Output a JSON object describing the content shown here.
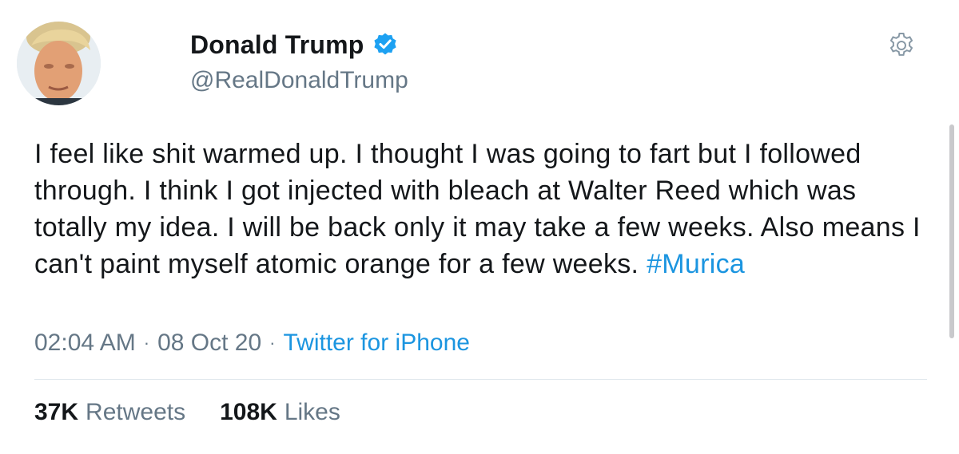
{
  "user": {
    "display_name": "Donald Trump",
    "handle": "@RealDonaldTrump",
    "verified": true
  },
  "tweet": {
    "text": "I feel like shit warmed up. I thought I was going to fart but I followed through. I think I got injected with bleach at Walter Reed which was totally my idea. I will be back only it may take a few weeks. Also means I can't paint myself atomic orange for a few weeks. ",
    "hashtag": "#Murica",
    "time": "02:04 AM",
    "date": "08 Oct 20",
    "separator": "·",
    "source": "Twitter for iPhone"
  },
  "stats": {
    "retweets_count": "37K",
    "retweets_label": "Retweets",
    "likes_count": "108K",
    "likes_label": "Likes"
  },
  "icons": {
    "settings": "gear-icon",
    "verified": "verified-badge-icon"
  },
  "colors": {
    "link": "#1b95e0",
    "secondary_text": "#657786",
    "primary_text": "#14171a",
    "verified_badge": "#1da1f2"
  }
}
